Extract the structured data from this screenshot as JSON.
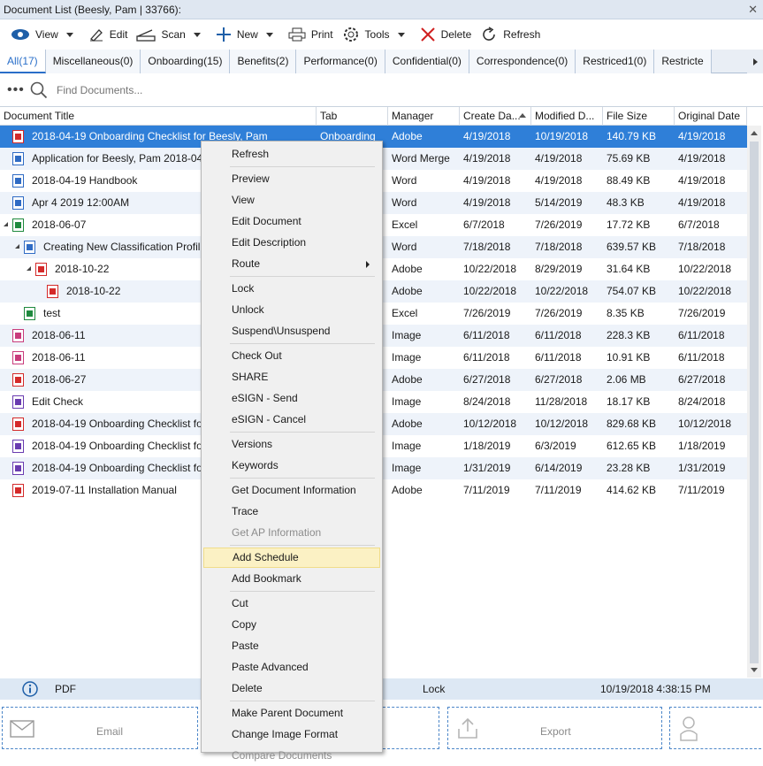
{
  "window": {
    "title": "Document List (Beesly, Pam | 33766):"
  },
  "toolbar": {
    "view_label": "View",
    "edit_label": "Edit",
    "scan_label": "Scan",
    "new_label": "New",
    "print_label": "Print",
    "tools_label": "Tools",
    "delete_label": "Delete",
    "refresh_label": "Refresh"
  },
  "tabs": [
    {
      "label": "All(17)"
    },
    {
      "label": "Miscellaneous(0)"
    },
    {
      "label": "Onboarding(15)"
    },
    {
      "label": "Benefits(2)"
    },
    {
      "label": "Performance(0)"
    },
    {
      "label": "Confidential(0)"
    },
    {
      "label": "Correspondence(0)"
    },
    {
      "label": "Restriced1(0)"
    },
    {
      "label": "Restricte"
    }
  ],
  "search": {
    "placeholder": "Find Documents..."
  },
  "grid": {
    "headers": [
      "Document Title",
      "Tab",
      "Manager",
      "Create Da...",
      "Modified D...",
      "File Size",
      "Original Date"
    ],
    "rows": [
      {
        "icon": "pdf-icon",
        "title": "2018-04-19 Onboarding Checklist for Beesly, Pam",
        "tab": "Onboarding",
        "manager": "Adobe",
        "created": "4/19/2018",
        "modified": "10/19/2018",
        "size": "140.79 KB",
        "original": "4/19/2018"
      },
      {
        "icon": "word-icon",
        "title": "Application for Beesly, Pam 2018-04",
        "tab": "",
        "manager": "Word Merge",
        "created": "4/19/2018",
        "modified": "4/19/2018",
        "size": "75.69 KB",
        "original": "4/19/2018"
      },
      {
        "icon": "word-icon",
        "title": "2018-04-19 Handbook",
        "tab": "",
        "manager": "Word",
        "created": "4/19/2018",
        "modified": "4/19/2018",
        "size": "88.49 KB",
        "original": "4/19/2018"
      },
      {
        "icon": "word-icon",
        "title": "Apr  4 2019 12:00AM",
        "tab": "",
        "manager": "Word",
        "created": "4/19/2018",
        "modified": "5/14/2019",
        "size": "48.3 KB",
        "original": "4/19/2018"
      },
      {
        "icon": "excel-icon",
        "title": "2018-06-07",
        "tab": "",
        "manager": "Excel",
        "created": "6/7/2018",
        "modified": "7/26/2019",
        "size": "17.72 KB",
        "original": "6/7/2018"
      },
      {
        "icon": "word-icon",
        "title": "Creating New Classification Profil",
        "tab": "",
        "manager": "Word",
        "created": "7/18/2018",
        "modified": "7/18/2018",
        "size": "639.57 KB",
        "original": "7/18/2018"
      },
      {
        "icon": "pdf-icon",
        "title": "2018-10-22",
        "tab": "",
        "manager": "Adobe",
        "created": "10/22/2018",
        "modified": "8/29/2019",
        "size": "31.64 KB",
        "original": "10/22/2018"
      },
      {
        "icon": "pdf-icon",
        "title": "2018-10-22",
        "tab": "",
        "manager": "Adobe",
        "created": "10/22/2018",
        "modified": "10/22/2018",
        "size": "754.07 KB",
        "original": "10/22/2018"
      },
      {
        "icon": "excel-icon",
        "title": "test",
        "tab": "",
        "manager": "Excel",
        "created": "7/26/2019",
        "modified": "7/26/2019",
        "size": "8.35 KB",
        "original": "7/26/2019"
      },
      {
        "icon": "image-icon",
        "title": "2018-06-11",
        "tab": "",
        "manager": "Image",
        "created": "6/11/2018",
        "modified": "6/11/2018",
        "size": "228.3 KB",
        "original": "6/11/2018"
      },
      {
        "icon": "image-icon",
        "title": "2018-06-11",
        "tab": "",
        "manager": "Image",
        "created": "6/11/2018",
        "modified": "6/11/2018",
        "size": "10.91 KB",
        "original": "6/11/2018"
      },
      {
        "icon": "pdf-icon",
        "title": "2018-06-27",
        "tab": "",
        "manager": "Adobe",
        "created": "6/27/2018",
        "modified": "6/27/2018",
        "size": "2.06 MB",
        "original": "6/27/2018"
      },
      {
        "icon": "image-doc-icon",
        "title": "Edit Check",
        "tab": "",
        "manager": "Image",
        "created": "8/24/2018",
        "modified": "11/28/2018",
        "size": "18.17 KB",
        "original": "8/24/2018"
      },
      {
        "icon": "pdf-icon",
        "title": "2018-04-19 Onboarding Checklist fo",
        "tab": "",
        "manager": "Adobe",
        "created": "10/12/2018",
        "modified": "10/12/2018",
        "size": "829.68 KB",
        "original": "10/12/2018"
      },
      {
        "icon": "image-doc-icon",
        "title": "2018-04-19 Onboarding Checklist fo",
        "tab": "",
        "manager": "Image",
        "created": "1/18/2019",
        "modified": "6/3/2019",
        "size": "612.65 KB",
        "original": "1/18/2019"
      },
      {
        "icon": "image-doc-icon",
        "title": "2018-04-19 Onboarding Checklist fo",
        "tab": "",
        "manager": "Image",
        "created": "1/31/2019",
        "modified": "6/14/2019",
        "size": "23.28 KB",
        "original": "1/31/2019"
      },
      {
        "icon": "pdf-icon",
        "title": "2019-07-11 Installation Manual",
        "tab": "",
        "manager": "Adobe",
        "created": "7/11/2019",
        "modified": "7/11/2019",
        "size": "414.62 KB",
        "original": "7/11/2019"
      }
    ]
  },
  "context_menu": {
    "items": [
      {
        "label": "Refresh"
      },
      {
        "sep": true
      },
      {
        "label": "Preview"
      },
      {
        "label": "View"
      },
      {
        "label": "Edit Document"
      },
      {
        "label": "Edit Description"
      },
      {
        "label": "Route",
        "submenu": true
      },
      {
        "sep": true
      },
      {
        "label": "Lock"
      },
      {
        "label": "Unlock"
      },
      {
        "label": "Suspend\\Unsuspend"
      },
      {
        "sep": true
      },
      {
        "label": "Check Out"
      },
      {
        "label": "SHARE"
      },
      {
        "label": "eSIGN - Send"
      },
      {
        "label": "eSIGN - Cancel"
      },
      {
        "sep": true
      },
      {
        "label": "Versions"
      },
      {
        "label": "Keywords"
      },
      {
        "sep": true
      },
      {
        "label": "Get Document Information"
      },
      {
        "label": "Trace"
      },
      {
        "label": "Get AP Information",
        "disabled": true
      },
      {
        "sep": true
      },
      {
        "label": "Add Schedule",
        "highlighted": true
      },
      {
        "label": "Add Bookmark"
      },
      {
        "sep": true
      },
      {
        "label": "Cut"
      },
      {
        "label": "Copy"
      },
      {
        "label": "Paste"
      },
      {
        "label": "Paste Advanced"
      },
      {
        "label": "Delete"
      },
      {
        "sep": true
      },
      {
        "label": "Make Parent Document"
      },
      {
        "label": "Change Image Format"
      },
      {
        "label": "Compare Documents",
        "disabled": true
      }
    ]
  },
  "status": {
    "type": "PDF",
    "lock": "Lock",
    "timestamp": "10/19/2018 4:38:15 PM"
  },
  "actions": {
    "email_label": "Email",
    "export_label": "Export"
  }
}
